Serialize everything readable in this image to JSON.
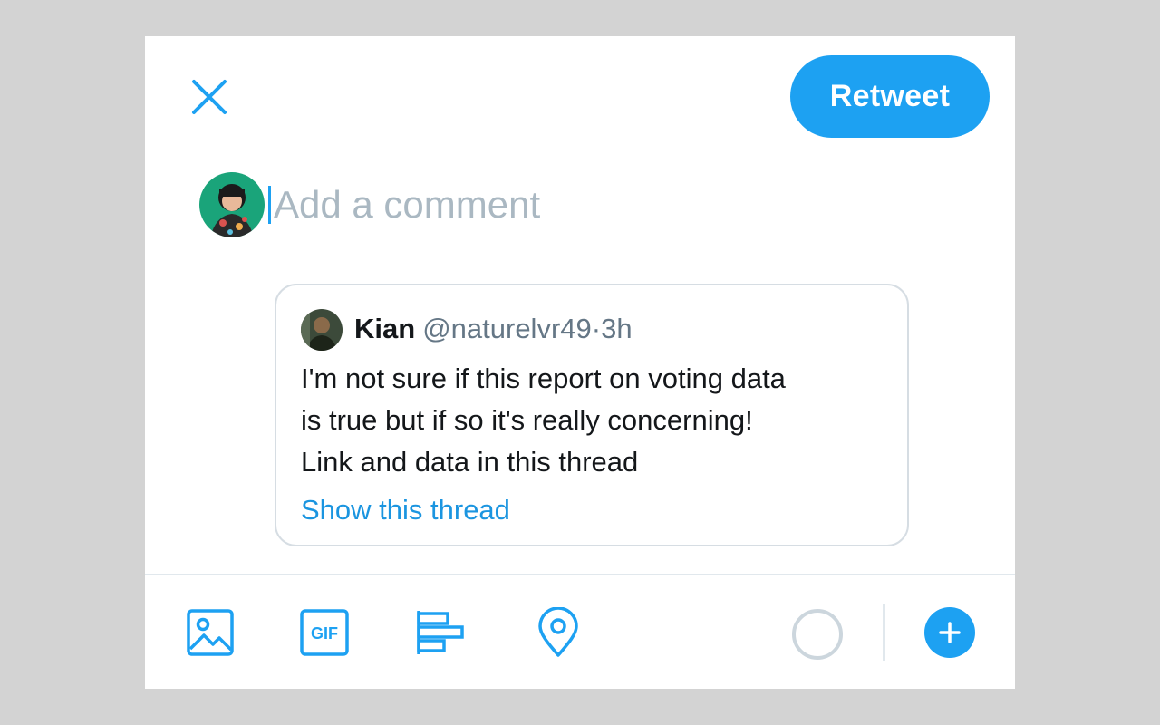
{
  "header": {
    "close_icon": "close-icon",
    "retweet_label": "Retweet"
  },
  "composer": {
    "placeholder": "Add a comment",
    "value": ""
  },
  "quoted_tweet": {
    "name": "Kian",
    "handle": "@naturelvr49",
    "separator": "·",
    "time": "3h",
    "text": "I'm not sure if this report on voting data\nis true but if so it's really concerning!\nLink and data in this thread",
    "link": "Show this thread"
  },
  "toolbar": {
    "items": [
      "image-icon",
      "gif-icon",
      "poll-icon",
      "location-icon"
    ],
    "gif_label": "GIF",
    "add_icon": "plus-icon"
  },
  "colors": {
    "accent": "#1da1f2",
    "link": "#1b95e0",
    "placeholder": "#aab8c2",
    "secondary_text": "#657786",
    "border": "#d6dde3"
  }
}
